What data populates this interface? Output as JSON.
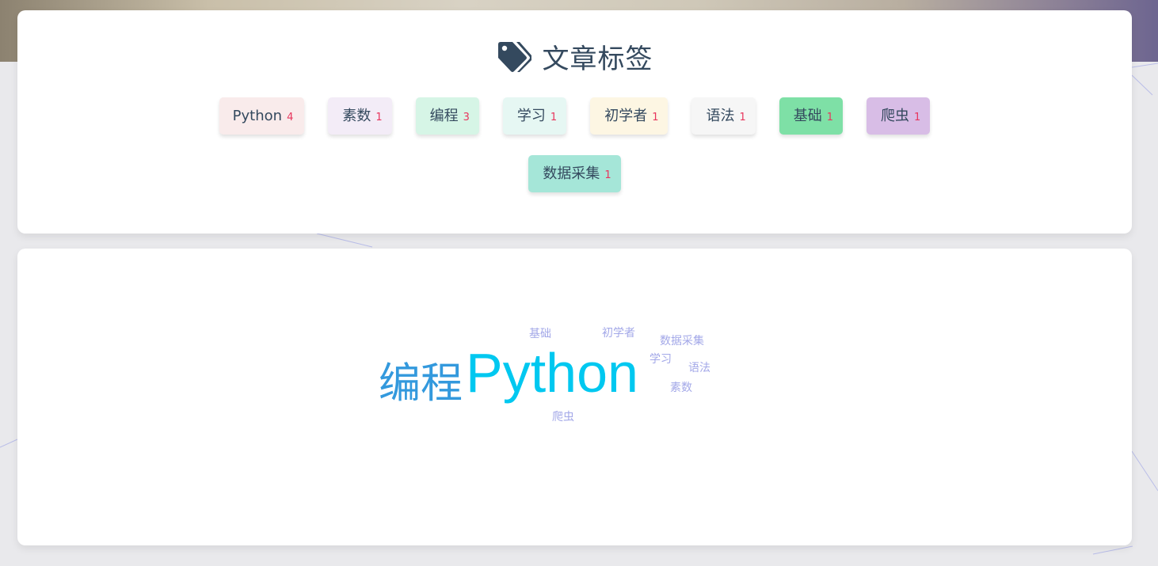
{
  "tags_section": {
    "title": "文章标签",
    "icon": "tags-icon",
    "tags": [
      {
        "label": "Python",
        "count": "4",
        "bg": "#f9ebeb"
      },
      {
        "label": "素数",
        "count": "1",
        "bg": "#f3ecf7"
      },
      {
        "label": "编程",
        "count": "3",
        "bg": "#d6f5e6"
      },
      {
        "label": "学习",
        "count": "1",
        "bg": "#e6f7f3"
      },
      {
        "label": "初学者",
        "count": "1",
        "bg": "#fdf6e3"
      },
      {
        "label": "语法",
        "count": "1",
        "bg": "#f6f6f6"
      },
      {
        "label": "基础",
        "count": "1",
        "bg": "#7ee0a6"
      },
      {
        "label": "爬虫",
        "count": "1",
        "bg": "#d8bde6"
      },
      {
        "label": "数据采集",
        "count": "1",
        "bg": "#a5e6d8"
      }
    ]
  },
  "word_cloud": {
    "words": [
      {
        "text": "Python",
        "color": "#00c8f0"
      },
      {
        "text": "编程",
        "color": "#3399dd"
      },
      {
        "text": "基础",
        "color": "#a3a8e8"
      },
      {
        "text": "初学者",
        "color": "#a3a8e8"
      },
      {
        "text": "数据采集",
        "color": "#a3a8e8"
      },
      {
        "text": "学习",
        "color": "#a3a8e8"
      },
      {
        "text": "语法",
        "color": "#a3a8e8"
      },
      {
        "text": "素数",
        "color": "#a3a8e8"
      },
      {
        "text": "爬虫",
        "color": "#a3a8e8"
      }
    ]
  }
}
